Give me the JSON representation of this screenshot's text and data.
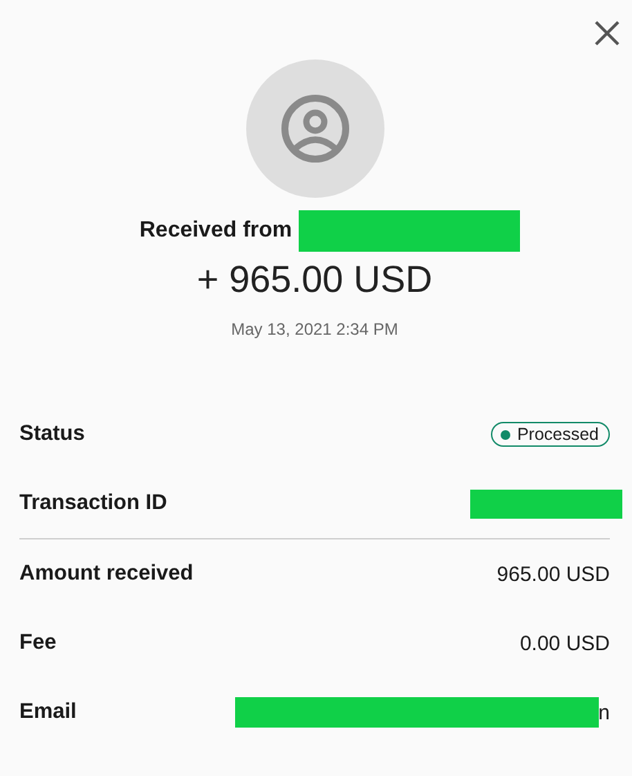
{
  "header": {
    "title": "Received from",
    "sender": {
      "kind": "redacted"
    },
    "amount": "+ 965.00 USD",
    "date": "May 13, 2021 2:34 PM"
  },
  "details": [
    {
      "label": "Status",
      "kind": "badge",
      "value": "Processed",
      "color": "#128a68",
      "divider": false
    },
    {
      "label": "Transaction ID",
      "kind": "redacted",
      "divider": true
    },
    {
      "label": "Amount received",
      "kind": "text",
      "value": "965.00 USD",
      "divider": false
    },
    {
      "label": "Fee",
      "kind": "text",
      "value": "0.00 USD",
      "divider": false
    },
    {
      "label": "Email",
      "kind": "redacted-tail",
      "value": "n",
      "divider": false
    }
  ]
}
